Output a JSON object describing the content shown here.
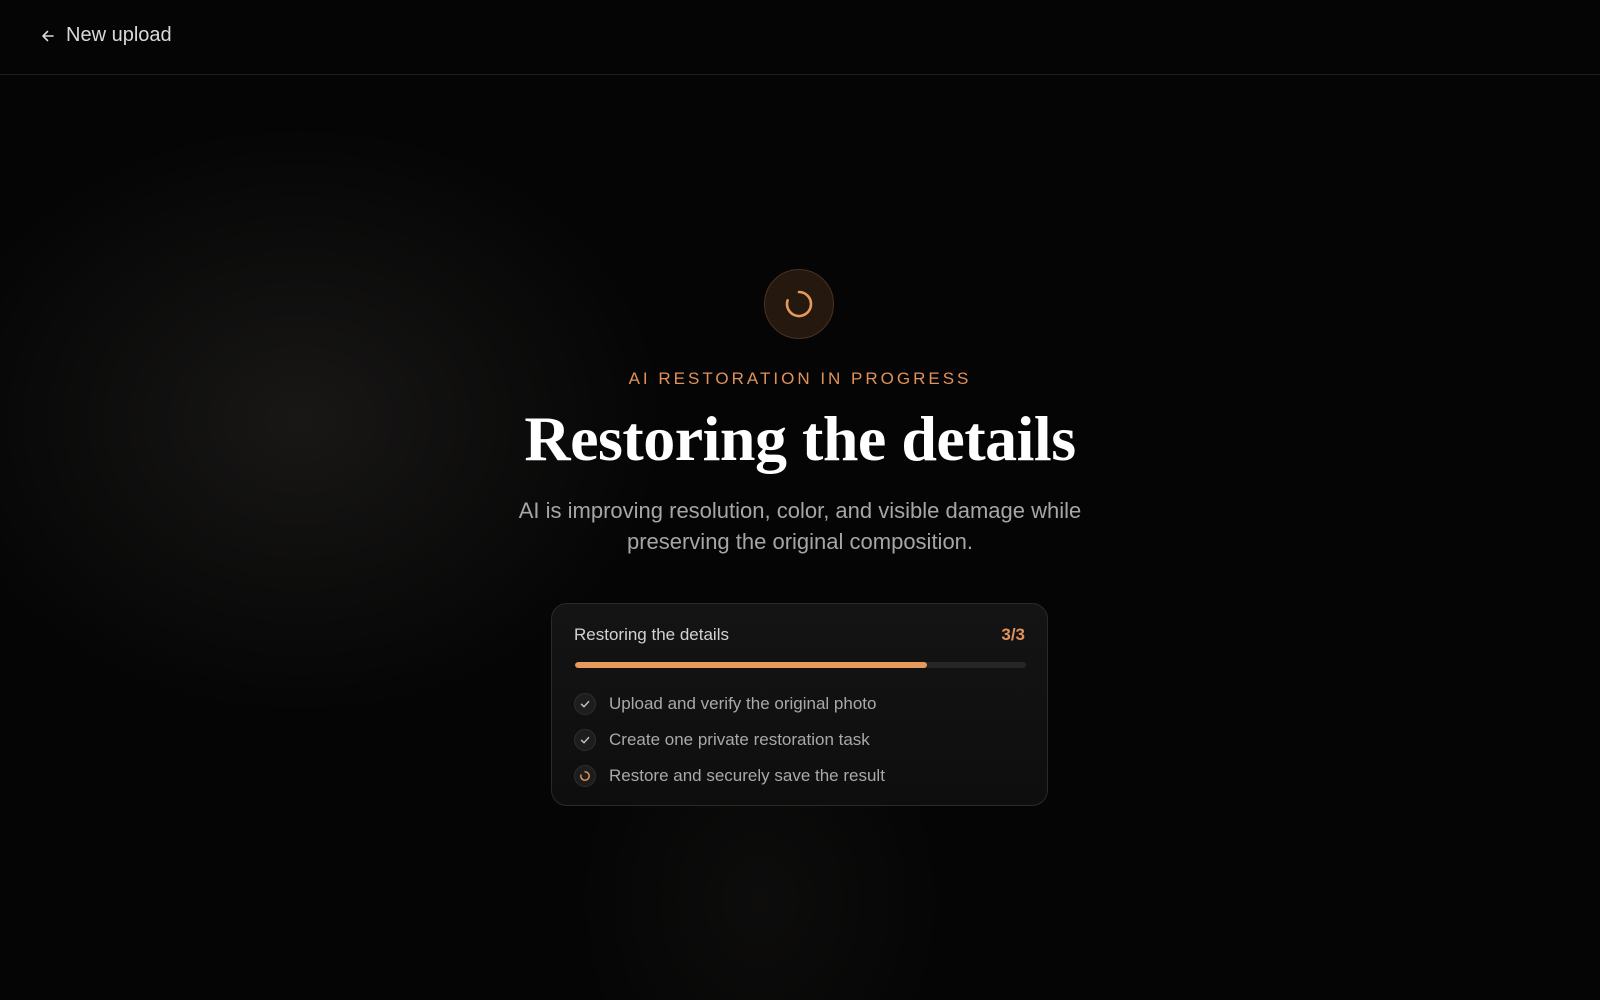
{
  "header": {
    "back_label": "New upload",
    "back_icon": "arrow-left-icon"
  },
  "main": {
    "spinner_icon": "loading-spinner-icon",
    "eyebrow": "AI RESTORATION IN PROGRESS",
    "title": "Restoring the details",
    "subtitle": "AI is improving resolution, color, and visible damage while preserving the original composition."
  },
  "progress_card": {
    "title": "Restoring the details",
    "count": "3/3",
    "progress_percent": 78,
    "steps": [
      {
        "label": "Upload and verify the original photo",
        "status": "done",
        "icon": "check-icon"
      },
      {
        "label": "Create one private restoration task",
        "status": "done",
        "icon": "check-icon"
      },
      {
        "label": "Restore and securely save the result",
        "status": "in-progress",
        "icon": "spinner-icon"
      }
    ]
  },
  "colors": {
    "accent": "#e69a5b",
    "background": "#050505",
    "card_border": "#2a2a2a"
  }
}
